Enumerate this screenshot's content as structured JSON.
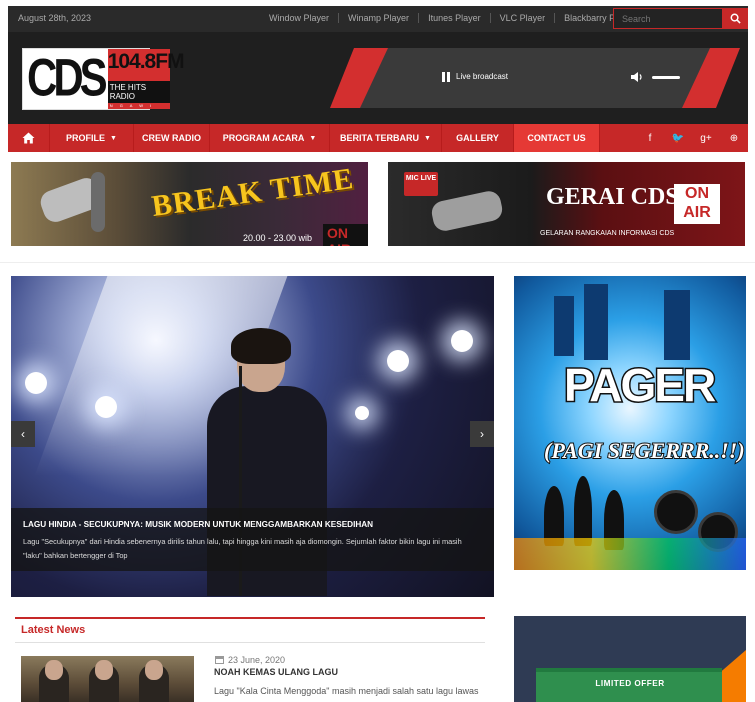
{
  "topbar": {
    "date": "August 28th, 2023",
    "players": [
      "Window Player",
      "Winamp Player",
      "Itunes Player",
      "VLC Player",
      "Blackbarry Player"
    ],
    "search_placeholder": "Search"
  },
  "header": {
    "logo_main": "CDS",
    "logo_freq": "104.8FM",
    "logo_tagline": "THE HITS RADIO",
    "logo_sub": "N G A W I",
    "player": {
      "status": "Live broadcast",
      "state_icon": "pause-icon",
      "volume_icon": "volume-icon",
      "volume_level": 0.9
    }
  },
  "nav": {
    "home_icon": "home-icon",
    "items": [
      {
        "label": "PROFILE",
        "dropdown": true
      },
      {
        "label": "CREW RADIO",
        "dropdown": false
      },
      {
        "label": "PROGRAM ACARA",
        "dropdown": true
      },
      {
        "label": "BERITA TERBARU",
        "dropdown": true
      },
      {
        "label": "GALLERY",
        "dropdown": false
      },
      {
        "label": "CONTACT US",
        "dropdown": false
      }
    ],
    "active": "CONTACT US",
    "social_icons": [
      "facebook-icon",
      "twitter-icon",
      "google-plus-icon",
      "pinterest-icon"
    ],
    "social_glyphs": [
      "f",
      "🐦",
      "g+",
      "⊕"
    ]
  },
  "banners": {
    "left": {
      "title": "BREAK TIME",
      "time": "20.00 - 23.00 wib",
      "badge": "ON AIR"
    },
    "right": {
      "mic_label": "MIC LIVE",
      "title": "GERAI CDS",
      "badge_line1": "ON",
      "badge_line2": "AIR",
      "subtitle": "GELARAN RANGKAIAN INFORMASI CDS"
    }
  },
  "slider": {
    "title": "LAGU HINDIA - SECUKUPNYA: MUSIK MODERN UNTUK MENGGAMBARKAN KESEDIHAN",
    "description": "Lagu \"Secukupnya\" dari Hindia sebenernya dirilis tahun lalu, tapi hingga kini masih aja diomongin. Sejumlah faktor bikin lagu ini masih \"laku\" bahkan bertengger di Top",
    "prev": "‹",
    "next": "›"
  },
  "side_ad": {
    "title": "PAGER",
    "subtitle": "(PAGI SEGERRR..!!)"
  },
  "latest_news": {
    "heading": "Latest News",
    "items": [
      {
        "date": "23 June, 2020",
        "headline": "NOAH KEMAS ULANG LAGU",
        "excerpt": "Lagu \"Kala Cinta Menggoda\" masih menjadi salah satu lagu lawas"
      }
    ]
  },
  "offer": {
    "label": "LIMITED OFFER"
  },
  "colors": {
    "accent": "#c62828",
    "topbar": "#2a2a2a",
    "header": "#1f1f1f"
  }
}
